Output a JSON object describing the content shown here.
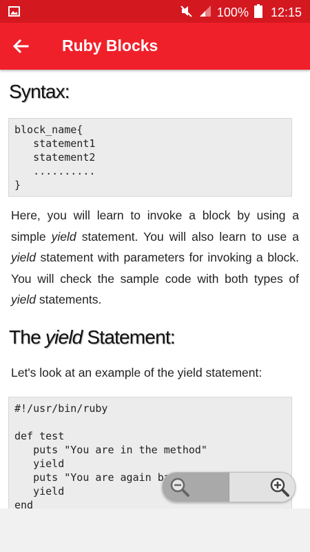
{
  "status_bar": {
    "battery": "100%",
    "time": "12:15",
    "icons": [
      "image-icon",
      "mute-icon",
      "signal-icon",
      "battery-icon"
    ]
  },
  "app_bar": {
    "title": "Ruby Blocks",
    "back_icon": "arrow-left-icon"
  },
  "content": {
    "syntax_heading": "Syntax:",
    "syntax_code": "block_name{\n   statement1\n   statement2\n   ..........\n}",
    "intro": {
      "p1": "Here, you will learn to invoke a block by using a simple ",
      "em1": "yield",
      "p2": " statement. You will also learn to use a ",
      "em2": "yield",
      "p3": " statement with parameters for invoking a block. You will check the sample code with both types of ",
      "em3": "yield",
      "p4": " statements."
    },
    "yield_heading": {
      "pre": "The ",
      "em": "yield",
      "post": " Statement:"
    },
    "example_intro": "Let's look at an example of the yield statement:",
    "example_code": "#!/usr/bin/ruby\n\ndef test\n   puts \"You are in the method\"\n   yield\n   puts \"You are again back from the method\"\n   yield\nend"
  },
  "zoom_controls": {
    "zoom_out_icon": "zoom-out-icon",
    "zoom_in_icon": "zoom-in-icon"
  },
  "colors": {
    "status_bar": "#d41820",
    "app_bar": "#f0202a",
    "code_background": "#ececec"
  }
}
